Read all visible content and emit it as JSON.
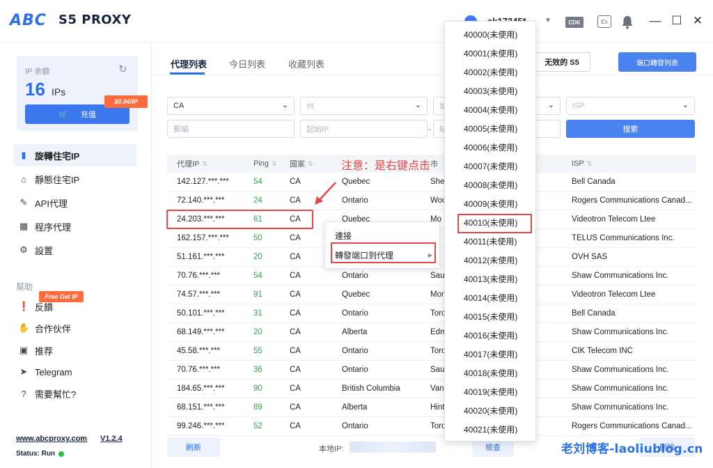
{
  "app": {
    "logo": "ABC",
    "name": "S5 PROXY",
    "user": "ak17345*",
    "cdk": "CDK",
    "lang_badge": "En"
  },
  "sidebar": {
    "ip_balance_label": "IP 余额",
    "ip_count": "16",
    "ip_unit": "IPs",
    "recharge": "充值",
    "price_tag": "$0.04/IP",
    "nav": [
      {
        "label": "旋轉住宅IP"
      },
      {
        "label": "靜態住宅IP"
      },
      {
        "label": "API代理"
      },
      {
        "label": "程序代理"
      },
      {
        "label": "設置"
      }
    ],
    "help_title": "幫助",
    "free_tag": "Free Get IP",
    "help": [
      {
        "label": "反饋"
      },
      {
        "label": "合作伙伴"
      },
      {
        "label": "推荐"
      },
      {
        "label": "Telegram"
      },
      {
        "label": "需要幫忙?"
      }
    ],
    "site": "www.abcproxy.com",
    "version": "V1.2.4",
    "status": "Status: Run"
  },
  "tabs": [
    "代理列表",
    "今日列表",
    "收藏列表"
  ],
  "buttons": {
    "invalid_s5": "无效的 S5",
    "port_forward_list": "端口轉發列表",
    "search": "搜索",
    "refresh": "刷新",
    "check": "檢查",
    "delete": "删除",
    "connect": "連接",
    "forward_port": "轉發端口到代理"
  },
  "filters": {
    "country": "CA",
    "state_ph": "州",
    "city_ph": "城",
    "isp_ph": "ISP",
    "zip_ph": "郵編",
    "start_ip_ph": "起始IP",
    "end_ip_ph": "結",
    "range_sep": "-"
  },
  "table": {
    "headers": [
      "代理IP",
      "Ping",
      "國家",
      "市",
      "ISP"
    ],
    "rows": [
      [
        "142.127.***.***",
        "54",
        "CA",
        "Quebec",
        "Sher",
        "Bell Canada"
      ],
      [
        "72.140.***.***",
        "24",
        "CA",
        "Ontario",
        "Woo",
        "Rogers Communications Canad..."
      ],
      [
        "24.203.***.***",
        "61",
        "CA",
        "Quebec",
        "Mo",
        "Videotron Telecom Ltee"
      ],
      [
        "162.157.***.***",
        "50",
        "CA",
        "",
        "",
        "TELUS Communications Inc."
      ],
      [
        "51.161.***.***",
        "20",
        "CA",
        "",
        "",
        "OVH SAS"
      ],
      [
        "70.76.***.***",
        "54",
        "CA",
        "Ontario",
        "Saul",
        "Shaw Communications Inc."
      ],
      [
        "74.57.***.***",
        "91",
        "CA",
        "Quebec",
        "Mon",
        "Videotron Telecom Ltee"
      ],
      [
        "50.101.***.***",
        "31",
        "CA",
        "Ontario",
        "Toro",
        "Bell Canada"
      ],
      [
        "68.149.***.***",
        "20",
        "CA",
        "Alberta",
        "Edm",
        "Shaw Communications Inc."
      ],
      [
        "45.58.***.***",
        "55",
        "CA",
        "Ontario",
        "Toro",
        "CIK Telecom INC"
      ],
      [
        "70.76.***.***",
        "36",
        "CA",
        "Ontario",
        "Saul",
        "Shaw Communications Inc."
      ],
      [
        "184.65.***.***",
        "90",
        "CA",
        "British Columbia",
        "Vanc",
        "Shaw Communications Inc."
      ],
      [
        "68.151.***.***",
        "89",
        "CA",
        "Alberta",
        "Hint",
        "Shaw Communications Inc."
      ],
      [
        "99.246.***.***",
        "52",
        "CA",
        "Ontario",
        "Toro",
        "Rogers Communications Canad..."
      ]
    ]
  },
  "annotation": "注意：是右键点击",
  "local_ip_label": "本地IP:",
  "ports": [
    "40000(未使用)",
    "40001(未使用)",
    "40002(未使用)",
    "40003(未使用)",
    "40004(未使用)",
    "40005(未使用)",
    "40006(未使用)",
    "40007(未使用)",
    "40008(未使用)",
    "40009(未使用)",
    "40010(未使用)",
    "40011(未使用)",
    "40012(未使用)",
    "40013(未使用)",
    "40014(未使用)",
    "40015(未使用)",
    "40016(未使用)",
    "40017(未使用)",
    "40018(未使用)",
    "40019(未使用)",
    "40020(未使用)",
    "40021(未使用)"
  ],
  "watermark": "老刘博客-laoliublog.cn",
  "colors": {
    "accent": "#2b6fe6",
    "highlight": "#e84545",
    "ping": "#27a84a",
    "tag": "#ff6b3d"
  }
}
